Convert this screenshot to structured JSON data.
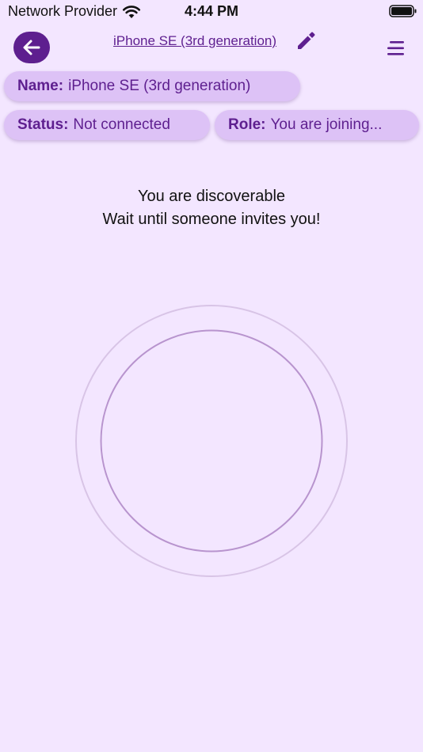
{
  "status_bar": {
    "carrier": "Network Provider",
    "time": "4:44 PM"
  },
  "header": {
    "title": "iPhone SE (3rd generation)"
  },
  "chips": {
    "name_key": "Name:",
    "name_value": "iPhone SE (3rd generation)",
    "status_key": "Status:",
    "status_value": "Not connected",
    "role_key": "Role:",
    "role_value": "You are joining..."
  },
  "message": {
    "line1": "You are discoverable",
    "line2": "Wait until someone invites you!"
  },
  "colors": {
    "background": "#f3e6ff",
    "primary": "#5e1f8f",
    "chip": "#ddc2f6"
  },
  "icons": {
    "back": "arrow-left-icon",
    "edit": "pencil-icon",
    "menu": "menu-icon",
    "wifi": "wifi-icon",
    "battery": "battery-icon"
  }
}
